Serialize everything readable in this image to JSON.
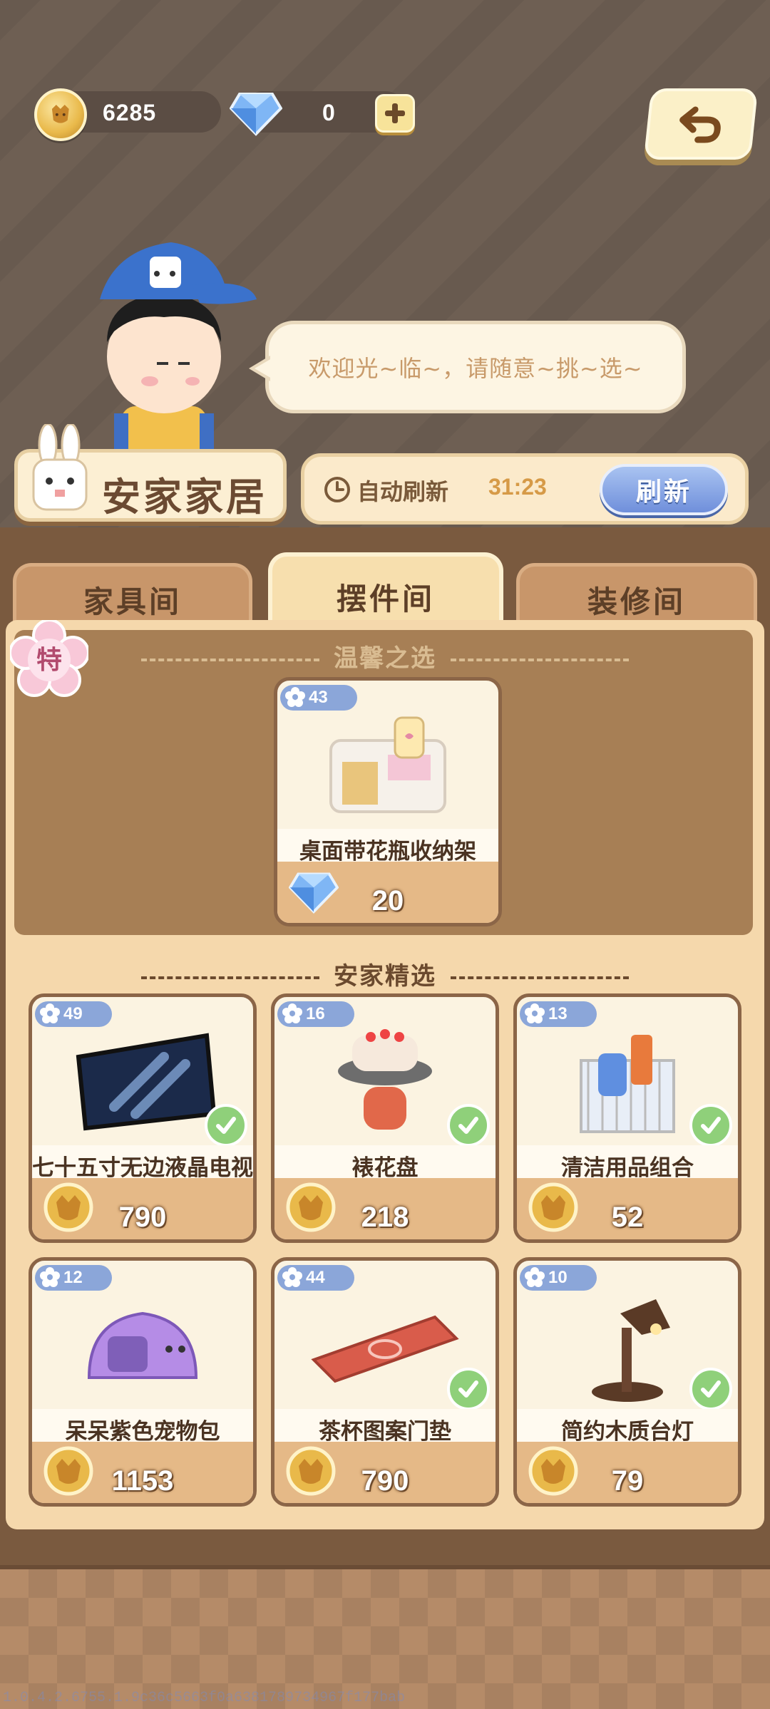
{
  "currency": {
    "coins": "6285",
    "gems": "0"
  },
  "npc": {
    "greeting": "欢迎光~临~，请随意~挑~选~"
  },
  "shop": {
    "name": "安家家居",
    "refresh_label": "自动刷新",
    "refresh_timer": "31:23",
    "refresh_button": "刷新"
  },
  "tabs": [
    {
      "label": "家具间",
      "active": false
    },
    {
      "label": "摆件间",
      "active": true
    },
    {
      "label": "装修间",
      "active": false
    }
  ],
  "special": {
    "badge": "特",
    "section_title": "温馨之选",
    "item": {
      "level": "43",
      "name": "桌面带花瓶收纳架",
      "price": "20",
      "currency": "gem"
    }
  },
  "featured": {
    "section_title": "安家精选",
    "items": [
      {
        "level": "49",
        "name": "七十五寸无边液晶电视",
        "price": "790",
        "owned": true
      },
      {
        "level": "16",
        "name": "裱花盘",
        "price": "218",
        "owned": true
      },
      {
        "level": "13",
        "name": "清洁用品组合",
        "price": "52",
        "owned": true
      },
      {
        "level": "12",
        "name": "呆呆紫色宠物包",
        "price": "1153",
        "owned": false
      },
      {
        "level": "44",
        "name": "茶杯图案门垫",
        "price": "790",
        "owned": true
      },
      {
        "level": "10",
        "name": "简约木质台灯",
        "price": "79",
        "owned": true
      }
    ]
  },
  "version": "1.0.4.2.6755.1.9c36c5663f0a6381789734967f177bab",
  "colors": {
    "background": "#6e5f53",
    "panel": "#f5d8ac",
    "accent_blue": "#8ba6d9",
    "check_green": "#8fd07a"
  }
}
